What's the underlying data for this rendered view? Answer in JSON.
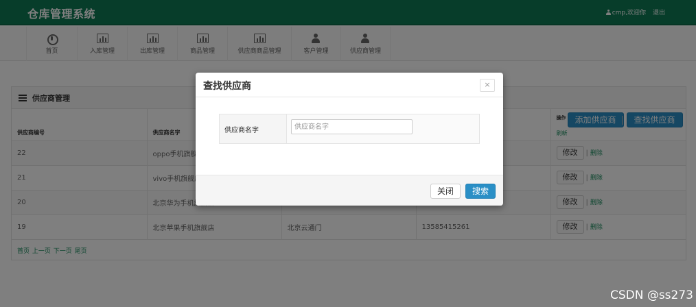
{
  "app": {
    "title": "仓库管理系统"
  },
  "user": {
    "greeting": "cmp,欢迎你",
    "logout": "退出"
  },
  "nav": [
    {
      "label": "首页",
      "icon": "home-icon"
    },
    {
      "label": "入库管理",
      "icon": "chart-icon"
    },
    {
      "label": "出库管理",
      "icon": "chart-icon"
    },
    {
      "label": "商品管理",
      "icon": "chart-icon"
    },
    {
      "label": "供应商商品管理",
      "icon": "chart-icon"
    },
    {
      "label": "客户管理",
      "icon": "person-icon"
    },
    {
      "label": "供应商管理",
      "icon": "person-icon"
    }
  ],
  "panel": {
    "title": "供应商管理",
    "columns": [
      "供应商编号",
      "供应商名字",
      "",
      ""
    ],
    "ops": {
      "label": "操作",
      "refresh": "刷新",
      "add": "添加供应商",
      "find": "查找供应商"
    },
    "rows": [
      {
        "id": "22",
        "name": "oppo手机旗舰店",
        "address": "",
        "phone": ""
      },
      {
        "id": "21",
        "name": "vivo手机旗舰店",
        "address": "",
        "phone": ""
      },
      {
        "id": "20",
        "name": "北京华为手机旗舰店",
        "address": "",
        "phone": ""
      },
      {
        "id": "19",
        "name": "北京苹果手机旗舰店",
        "address": "北京云通门",
        "phone": "13585415261"
      }
    ],
    "row_edit": "修改",
    "row_delete": "删除",
    "pager": "首页 上一页 下一页 尾页"
  },
  "modal": {
    "title": "查找供应商",
    "close_glyph": "×",
    "field_label": "供应商名字",
    "field_placeholder": "供应商名字",
    "field_value": "",
    "btn_close": "关闭",
    "btn_search": "搜索"
  },
  "watermark": "CSDN @ss273",
  "colors": {
    "header": "#0f7a55",
    "primary": "#2a8fc6",
    "link": "#1a8c5e"
  }
}
